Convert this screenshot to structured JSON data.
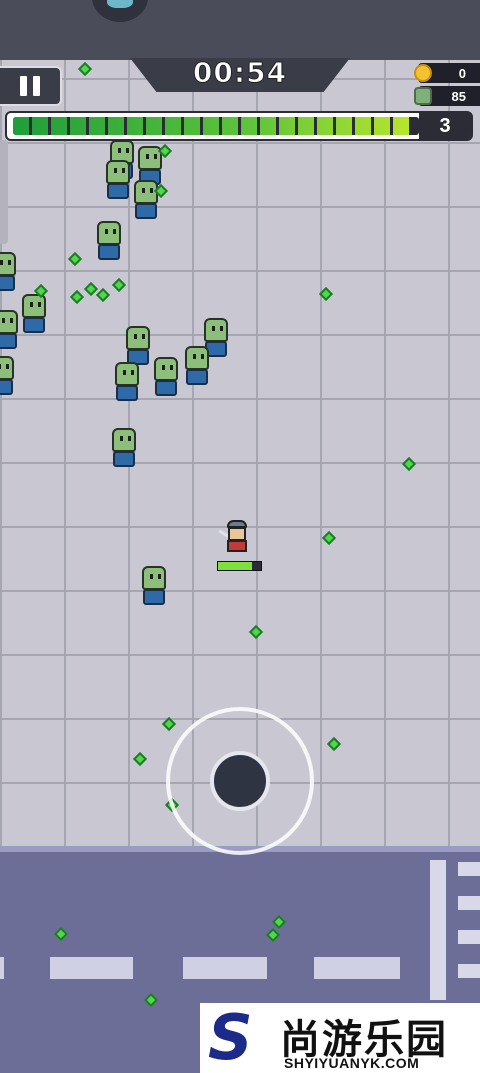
{
  "hud": {
    "timer": "00:54",
    "coins": "0",
    "kills": "85",
    "level": "3",
    "xp_progress": 0.98,
    "player_health": 0.78
  },
  "icons": {
    "pause": "pause-icon",
    "coin": "coin-icon",
    "kills": "zombie-skull-icon",
    "boss": "boss-indicator-icon"
  },
  "colors": {
    "xp_fill_start": "#1f9e3a",
    "xp_fill_end": "#b8e62d",
    "health": "#7fe03c",
    "gem": "#4fd84a",
    "floor": "#c9c8d2",
    "road": "#6d6e98"
  },
  "watermark": {
    "letter": "S",
    "text_cn": "尚游乐园",
    "text_en": "SHYIYUANYK.COM"
  }
}
